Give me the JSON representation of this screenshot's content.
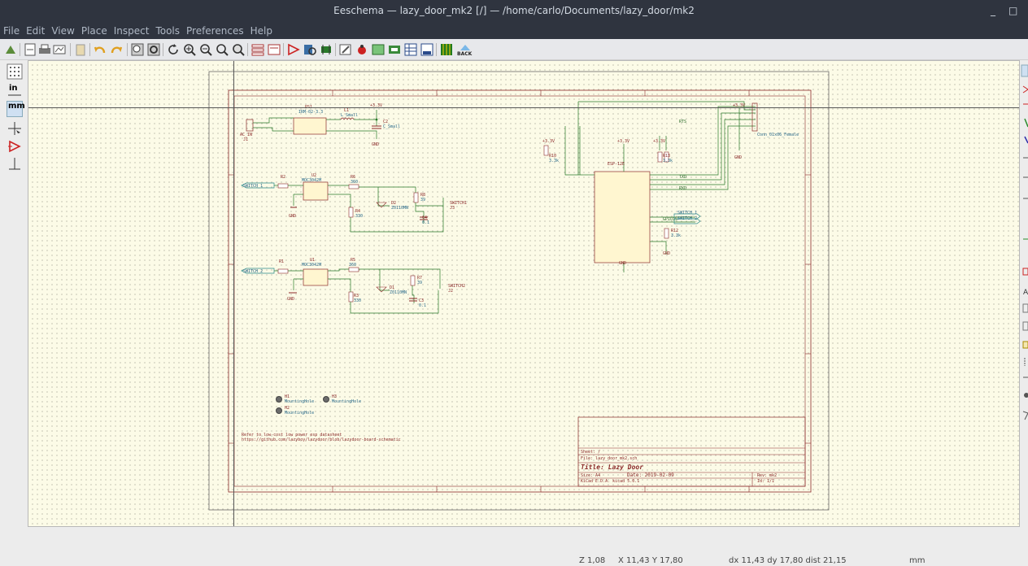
{
  "window": {
    "title": "Eeschema — lazy_door_mk2 [/] — /home/carlo/Documents/lazy_door/mk2",
    "minimize": "_",
    "restore": "□"
  },
  "menu": [
    "File",
    "Edit",
    "View",
    "Place",
    "Inspect",
    "Tools",
    "Preferences",
    "Help"
  ],
  "toolbar": {
    "back_label": "BACK"
  },
  "left_tools": {
    "grid_label": "",
    "inch_label": "in",
    "mm_label": "mm"
  },
  "schematic": {
    "title_block": {
      "sheet": "Sheet: /",
      "file": "File: lazy_door_mk2.sch",
      "title": "Title: Lazy Door",
      "size": "Size: A4",
      "date": "Date: 2019-02-09",
      "rev": "Rev: mk2",
      "kicad": "KiCad E.D.A.  kicad 5.0.1",
      "id": "Id: 1/1"
    },
    "labels": {
      "switch1": "SWITCH_1",
      "switch2": "SWITCH_2",
      "ps1": "PS1",
      "ps1_val": "IRM-02-3.3",
      "l1": "L1",
      "l1_val": "L_Small",
      "c2": "C2",
      "c2_val": "C_Small",
      "ac_in": "AC_IN",
      "j1": "J1",
      "u2": "U2",
      "u2_val": "MOC3042M",
      "u1": "U1",
      "u1_val": "MOC3042M",
      "r2": "R2",
      "r6": "R6",
      "r6_val": "360",
      "r4": "R4",
      "r4_val": "330",
      "d2": "D2",
      "d2_val": "Z0110MN",
      "r8": "R8",
      "r8_val": "39",
      "c4": "C4",
      "c4_val": "0.1",
      "sw1": "SWITCH1",
      "j3": "J3",
      "r1": "R1",
      "r5": "R5",
      "r5_val": "360",
      "r3": "R3",
      "r3_val": "330",
      "d1": "D1",
      "d1_val": "Z0110MN",
      "r7": "R7",
      "r7_val": "39",
      "c3": "C3",
      "c3_val": "0.1",
      "sw2": "SWITCH2",
      "j2": "J2",
      "u3": "ESP-12E",
      "r10": "R10",
      "r10_val": "3.3k",
      "r13": "R13",
      "r13_val": "3.3k",
      "r12": "R12",
      "r12_val": "3.3k",
      "j4": "Conn_01x06_Female",
      "rtx": "RTS",
      "txd": "TXD",
      "rxd": "RXD",
      "gpio15": "GPIO15",
      "sw_lbl1": "SWITCH_1",
      "sw_lbl2": "SWITCH_2",
      "gnd": "GND",
      "v33": "+3.3V",
      "h1": "H1",
      "h2": "H2",
      "h3": "H3",
      "mounting": "MountingHole",
      "note1": "Refer to low-cost low power esp datasheet",
      "note2": "https://github.com/lazyboy/lazydoor/blob/lazydoor-board-schematic"
    }
  },
  "status": {
    "zoom": "Z 1,08",
    "xy": "X 11,43  Y 17,80",
    "delta": "dx 11,43  dy 17,80  dist 21,15",
    "units": "mm"
  }
}
